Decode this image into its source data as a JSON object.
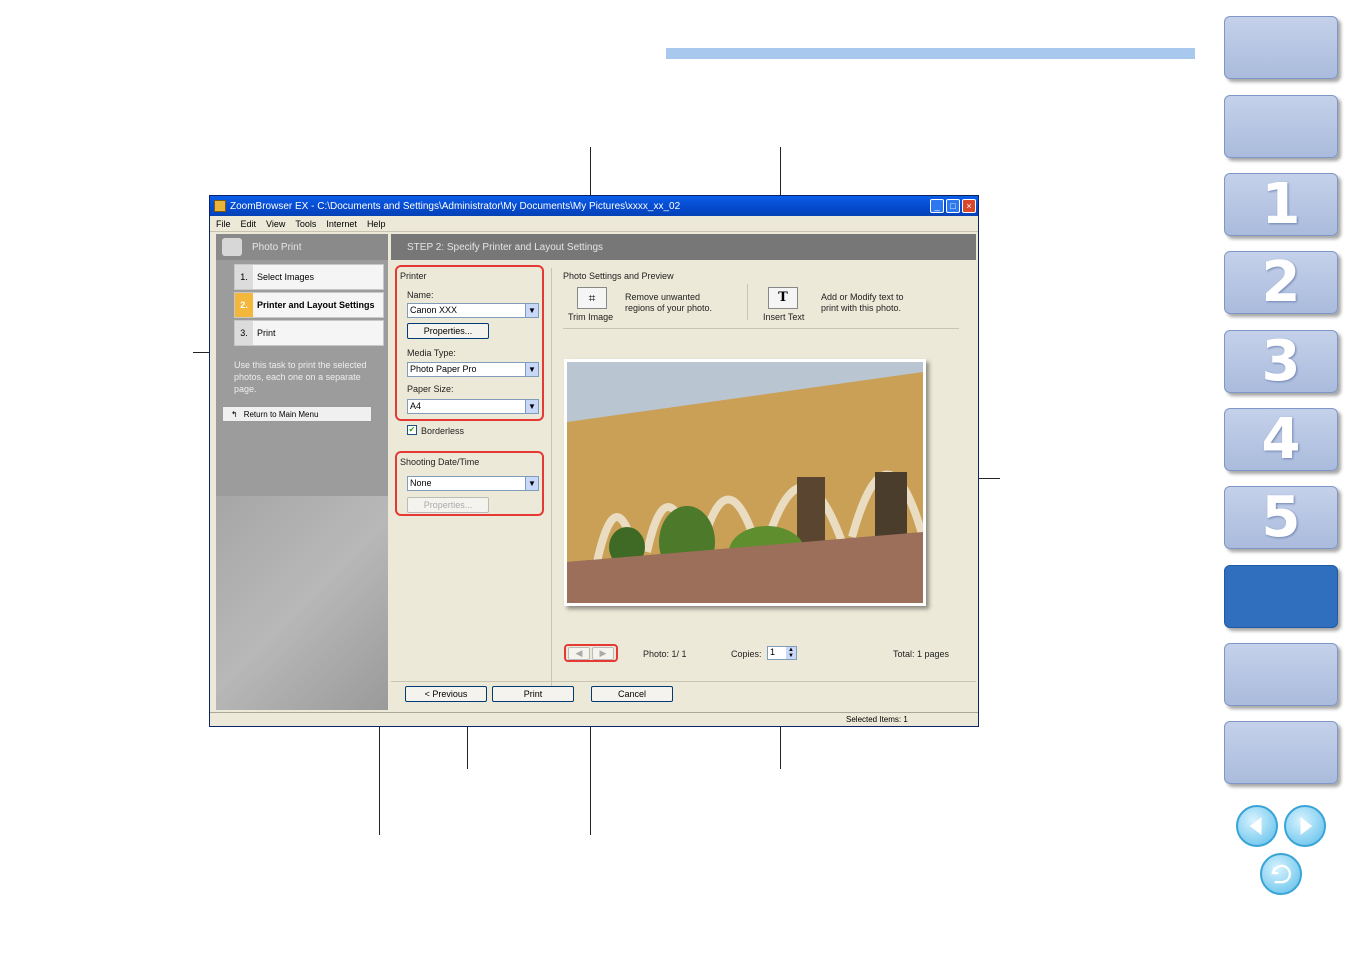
{
  "window": {
    "title": "ZoomBrowser EX  -  C:\\Documents and Settings\\Administrator\\My Documents\\My Pictures\\xxxx_xx_02",
    "menu": [
      "File",
      "Edit",
      "View",
      "Tools",
      "Internet",
      "Help"
    ],
    "status": "Selected Items: 1"
  },
  "left_pane": {
    "title": "Photo Print",
    "steps": [
      {
        "num": "1.",
        "label": "Select Images"
      },
      {
        "num": "2.",
        "label": "Printer and Layout Settings"
      },
      {
        "num": "3.",
        "label": "Print"
      }
    ],
    "description": "Use this task to print the selected photos, each one on a separate page.",
    "return_label": "Return to Main Menu"
  },
  "main": {
    "title": "STEP 2: Specify Printer and Layout Settings",
    "printer_group": "Printer",
    "name_label": "Name:",
    "name_value": "Canon XXX",
    "properties_label": "Properties...",
    "media_label": "Media Type:",
    "media_value": "Photo Paper Pro",
    "paper_label": "Paper Size:",
    "paper_value": "A4",
    "borderless_label": "Borderless",
    "date_group": "Shooting Date/Time",
    "date_value": "None",
    "date_properties": "Properties...",
    "preview_title": "Photo Settings and Preview",
    "trim_label": "Trim Image",
    "trim_desc": "Remove unwanted regions of your photo.",
    "text_label": "Insert Text",
    "text_desc": "Add or Modify text to print with this photo.",
    "photo_counter": "Photo: 1/ 1",
    "copies_label": "Copies:",
    "copies_value": "1",
    "total_pages": "Total: 1 pages",
    "prev_label": "< Previous",
    "print_label": "Print",
    "cancel_label": "Cancel"
  },
  "nav_tabs": [
    "",
    "",
    "1",
    "2",
    "3",
    "4",
    "5",
    "",
    ""
  ],
  "active_tab": 6,
  "colors": {
    "accent": "#2f6fbe",
    "tab": "#b7c6e4",
    "callout_box": "#e53935"
  }
}
